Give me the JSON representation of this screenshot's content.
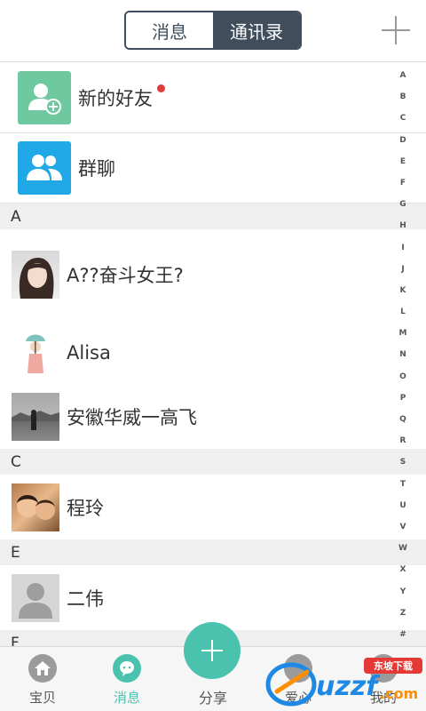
{
  "header": {
    "tab_messages": "消息",
    "tab_contacts": "通讯录",
    "add_icon": "plus-icon"
  },
  "features": [
    {
      "label": "新的好友",
      "icon": "add-friend-icon",
      "has_badge": true
    },
    {
      "label": "群聊",
      "icon": "group-chat-icon",
      "has_badge": false
    }
  ],
  "sections": [
    {
      "letter": "A",
      "contacts": [
        {
          "name": "A??奋斗女王?",
          "avatar": "photo-girl"
        },
        {
          "name": "Alisa",
          "avatar": "illustration-girl-umbrella"
        },
        {
          "name": "安徽华威一高飞",
          "avatar": "photo-landscape"
        }
      ]
    },
    {
      "letter": "C",
      "contacts": [
        {
          "name": "程玲",
          "avatar": "photo-family"
        }
      ]
    },
    {
      "letter": "E",
      "contacts": [
        {
          "name": "二伟",
          "avatar": "default-avatar"
        }
      ]
    },
    {
      "letter": "F",
      "contacts": []
    }
  ],
  "index_letters": [
    "A",
    "B",
    "C",
    "D",
    "E",
    "F",
    "G",
    "H",
    "I",
    "J",
    "K",
    "L",
    "M",
    "N",
    "O",
    "P",
    "Q",
    "R",
    "S",
    "T",
    "U",
    "V",
    "W",
    "X",
    "Y",
    "Z",
    "#"
  ],
  "bottom_nav": {
    "baobei": "宝贝",
    "messages": "消息",
    "share": "分享",
    "aixin": "爱心",
    "mine": "我的"
  },
  "watermark": {
    "brand": "uzzf.com",
    "badge": "东坡下载"
  },
  "colors": {
    "accent": "#4bc2ae",
    "header_dark": "#3f4d5c",
    "badge_red": "#e03a3a",
    "new_friend_bg": "#6fc9a0",
    "group_bg": "#21a8e6"
  }
}
